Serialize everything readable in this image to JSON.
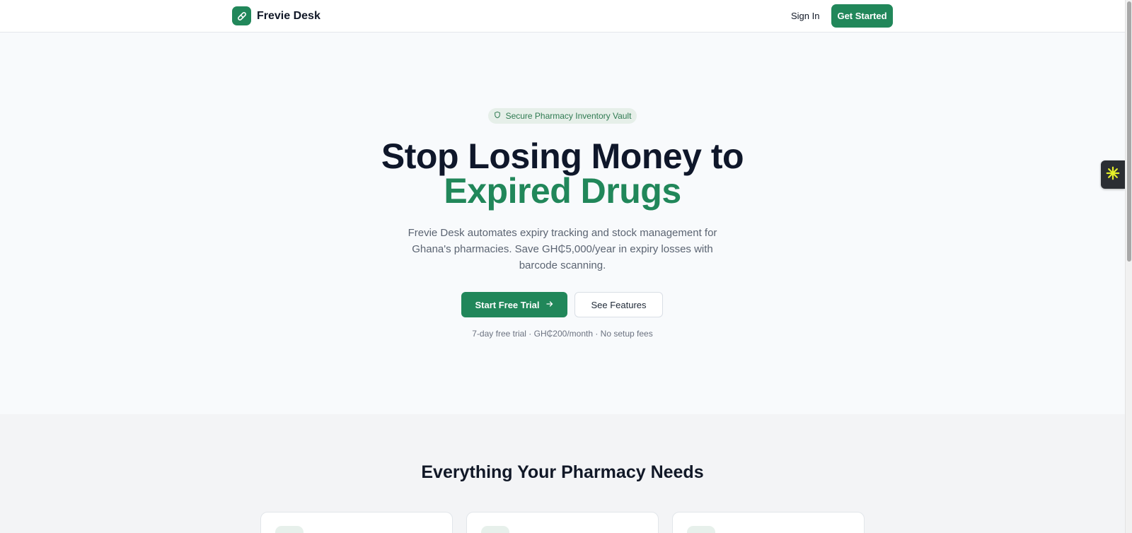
{
  "header": {
    "brand_name": "Frevie Desk",
    "signin_label": "Sign In",
    "get_started_label": "Get Started"
  },
  "hero": {
    "badge_text": "Secure Pharmacy Inventory Vault",
    "headline_line1": "Stop Losing Money to",
    "headline_line2": "Expired Drugs",
    "subtitle": "Frevie Desk automates expiry tracking and stock management for Ghana's pharmacies. Save GH₵5,000/year in expiry losses with barcode scanning.",
    "primary_cta": "Start Free Trial",
    "secondary_cta": "See Features",
    "fine_print": "7-day free trial · GH₵200/month · No setup fees"
  },
  "features": {
    "title": "Everything Your Pharmacy Needs"
  },
  "icons": {
    "brand": "pill-icon",
    "badge": "shield-icon",
    "primary_cta": "arrow-right-icon",
    "widget": "asterisk-icon"
  },
  "colors": {
    "accent": "#21875a",
    "hero_background": "#f8fafc",
    "features_background": "#f3f4f6",
    "headline": "#0f172a",
    "badge_background": "#e6efe9",
    "widget_glyph": "#e6f028"
  }
}
